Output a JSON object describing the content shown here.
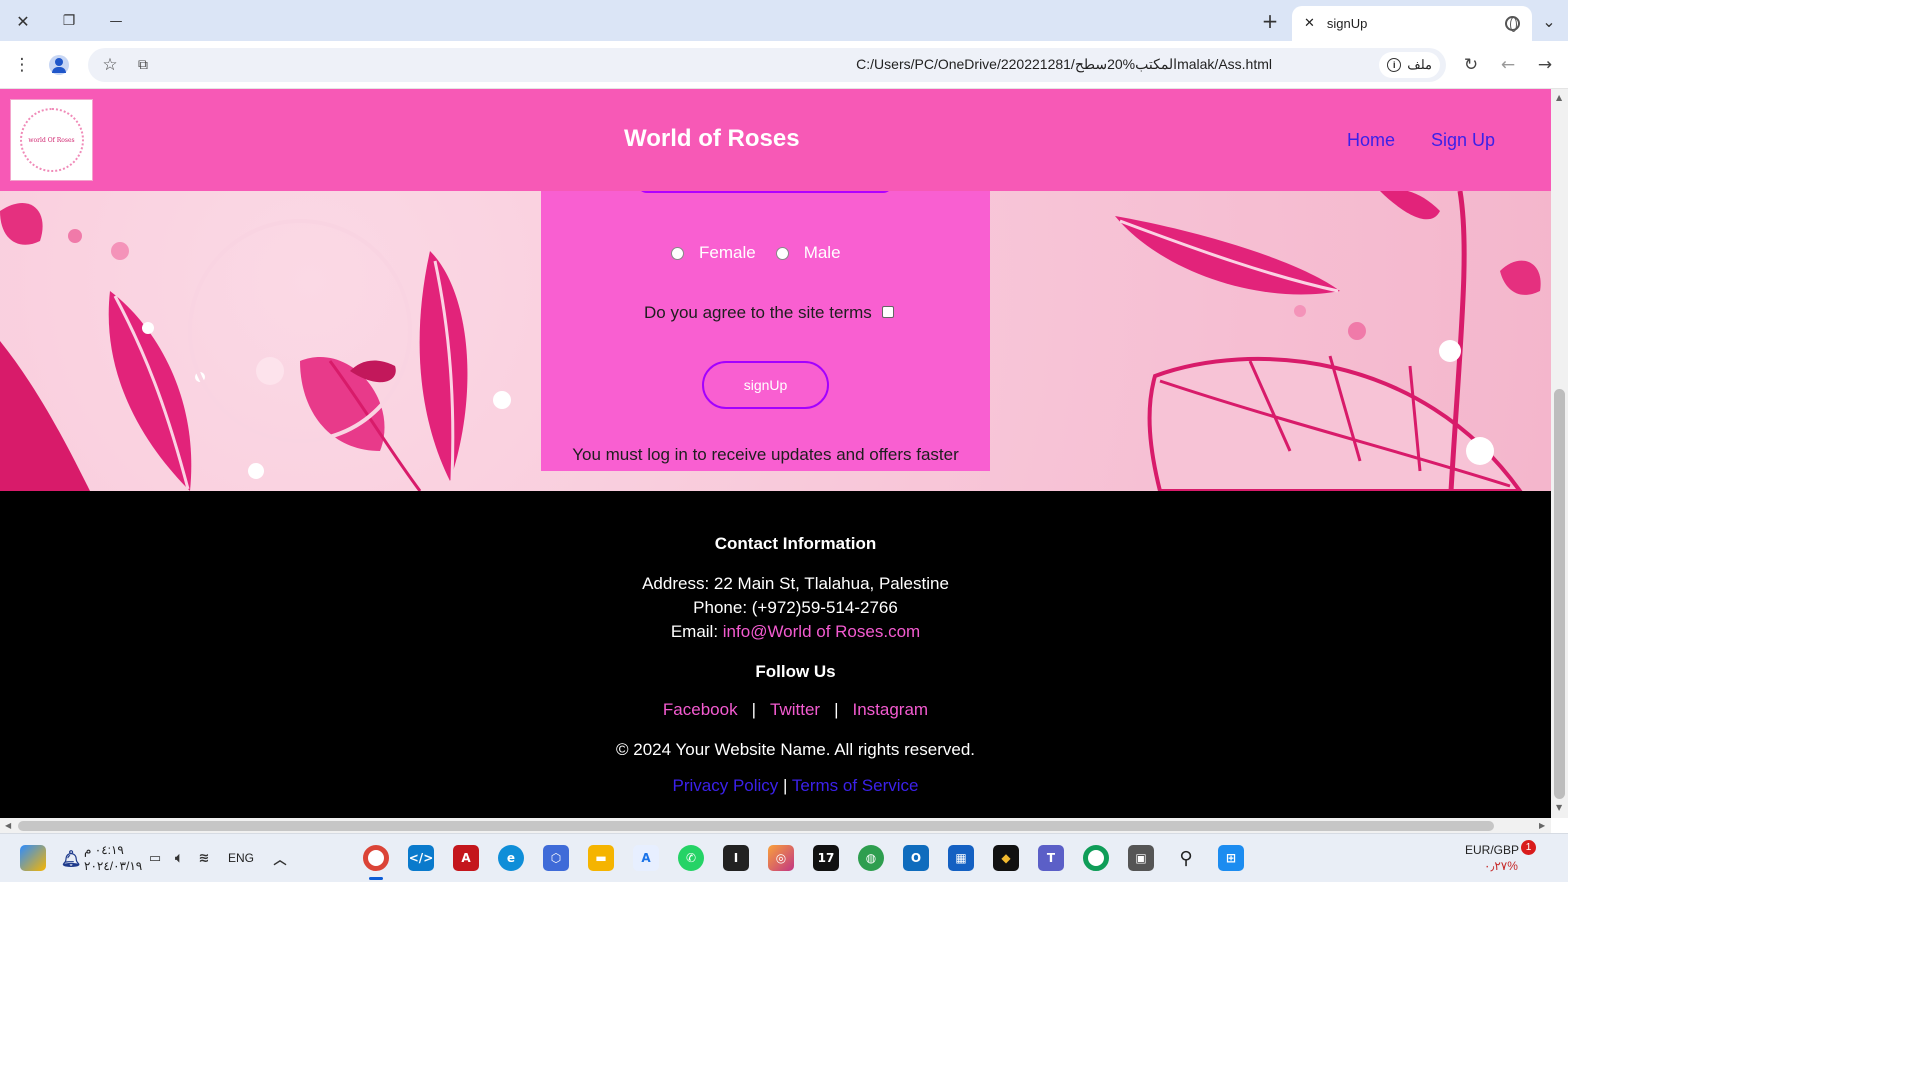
{
  "browser": {
    "tab_title": "signUp",
    "url": "C:/Users/PC/OneDrive/220221281/المكتب%20سطحmalak/Ass.html",
    "site_chip_label": "ملف",
    "window_close": "✕",
    "window_restore": "❐",
    "window_minimize": "—",
    "new_tab": "+",
    "tab_menu": "⌄"
  },
  "site": {
    "logo_text": "world Of Roses",
    "title": "World of Roses",
    "nav": [
      {
        "label": "Home"
      },
      {
        "label": "Sign Up"
      }
    ]
  },
  "form": {
    "gender_options": [
      "Female",
      "Male"
    ],
    "terms_label": "Do you agree to the site terms",
    "submit_label": "signUp",
    "note": "You must log in to receive updates and offers faster"
  },
  "footer": {
    "contact_heading": "Contact Information",
    "address": "Address: 22 Main St, Tlalahua, Palestine",
    "phone": "Phone: (+972)59-514-2766",
    "email_prefix": "Email: ",
    "email": "info@World of Roses.com",
    "follow_heading": "Follow Us",
    "social": [
      "Facebook",
      "Twitter",
      "Instagram"
    ],
    "social_separator": "|",
    "copyright": "© 2024 Your Website Name. All rights reserved.",
    "legal": [
      "Privacy Policy",
      "Terms of Service"
    ],
    "legal_separator": "|"
  },
  "taskbar": {
    "time": "٠٤:١٩ م",
    "date": "٢٠٢٤/٠٣/١٩",
    "language": "ENG",
    "ticker_name": "EUR/GBP",
    "ticker_value": "٠٫٢٧%",
    "notification_count": "1"
  },
  "colors": {
    "header_pink": "#f759b6",
    "form_pink": "#f95fd1",
    "nav_link": "#3b21e8",
    "footer_link": "#f35bd0",
    "footer_bg": "#000000"
  }
}
